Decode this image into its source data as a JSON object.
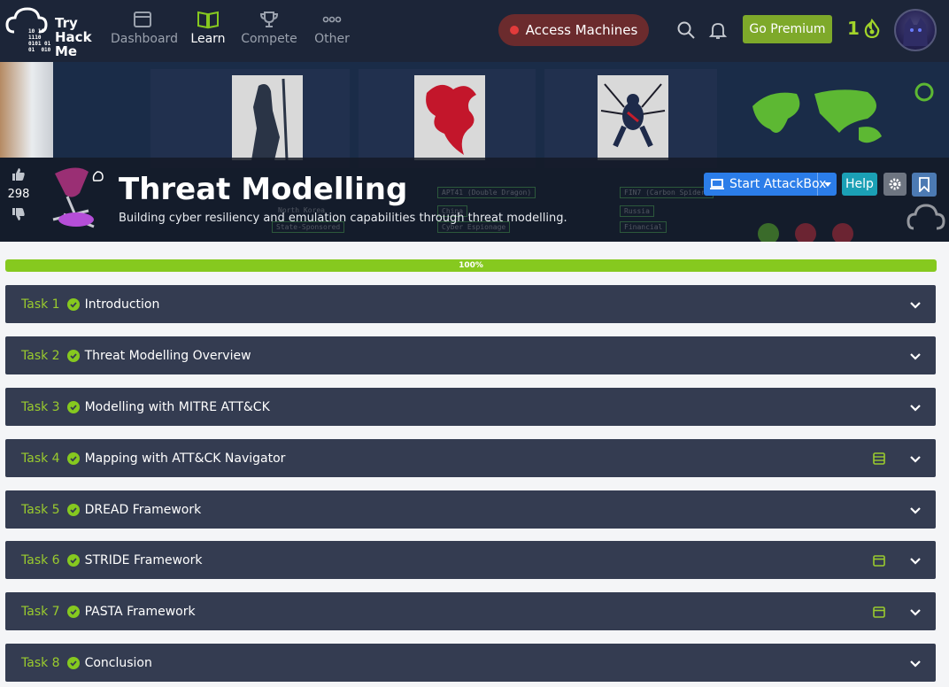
{
  "nav": {
    "logo_word": "Try\nHack\nMe",
    "logo_bits": "10 10\n1110\n0101 01\n01  010",
    "items": [
      {
        "label": "Dashboard",
        "icon": "browser-window-icon"
      },
      {
        "label": "Learn",
        "icon": "open-book-icon",
        "active": true
      },
      {
        "label": "Compete",
        "icon": "trophy-icon"
      },
      {
        "label": "Other",
        "icon": "more-dots-icon"
      }
    ],
    "access_label": "Access Machines",
    "premium_label": "Go Premium",
    "streak": "1"
  },
  "room": {
    "title": "Threat Modelling",
    "subtitle": "Building cyber resiliency and emulation capabilities through threat modelling.",
    "likes": "298",
    "attackbox_label": "Start AttackBox",
    "help_label": "Help",
    "banner_text": {
      "apt41": "APT41 (Double Dragon)",
      "fin7": "FIN7 (Carbon Spider)",
      "north_korea": "North Korea",
      "state_sponsored": "State-Sponsored",
      "china": "China",
      "cyber_espionage": "Cyber Espionage",
      "russia": "Russia",
      "financial": "Financial"
    }
  },
  "progress": {
    "percent_label": "100%",
    "value": 1.0
  },
  "tasks": [
    {
      "num": "Task 1",
      "name": "Introduction",
      "extra": ""
    },
    {
      "num": "Task 2",
      "name": "Threat Modelling Overview",
      "extra": ""
    },
    {
      "num": "Task 3",
      "name": "Modelling with MITRE ATT&CK",
      "extra": ""
    },
    {
      "num": "Task 4",
      "name": "Mapping with ATT&CK Navigator",
      "extra": "server-icon"
    },
    {
      "num": "Task 5",
      "name": "DREAD Framework",
      "extra": ""
    },
    {
      "num": "Task 6",
      "name": "STRIDE Framework",
      "extra": "calendar-icon"
    },
    {
      "num": "Task 7",
      "name": "PASTA Framework",
      "extra": "calendar-icon"
    },
    {
      "num": "Task 8",
      "name": "Conclusion",
      "extra": ""
    }
  ],
  "colors": {
    "nav_bg": "#1c2538",
    "task_bg": "#343c51",
    "accent_green": "#86c91f",
    "attackbox_blue": "#2b7de9",
    "help_teal": "#1ba0b5",
    "access_bg": "#6b2b2d"
  }
}
